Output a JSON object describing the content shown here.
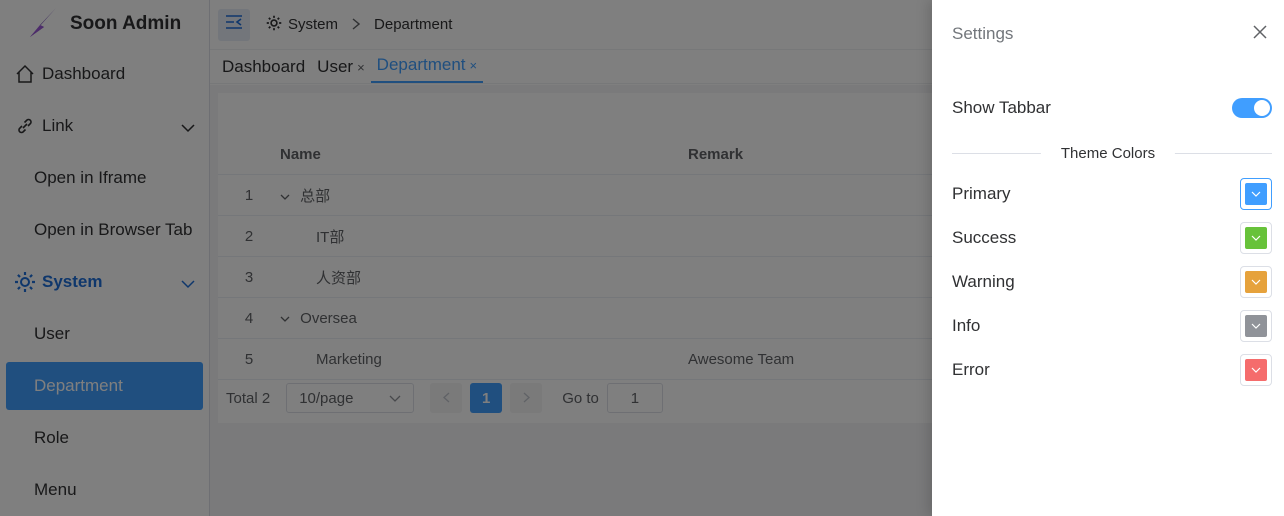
{
  "app": {
    "title": "Soon Admin"
  },
  "sidebar": {
    "items": [
      {
        "label": "Dashboard"
      },
      {
        "label": "Link"
      },
      {
        "label": "Open in Iframe"
      },
      {
        "label": "Open in Browser Tab"
      },
      {
        "label": "System"
      },
      {
        "label": "User"
      },
      {
        "label": "Department"
      },
      {
        "label": "Role"
      },
      {
        "label": "Menu"
      }
    ]
  },
  "breadcrumb": {
    "root": "System",
    "current": "Department"
  },
  "tabs": [
    {
      "label": "Dashboard"
    },
    {
      "label": "User",
      "close": "×"
    },
    {
      "label": "Department",
      "close": "×"
    }
  ],
  "table": {
    "columns": {
      "name": "Name",
      "remark": "Remark"
    },
    "rows": [
      {
        "index": "1",
        "name": "总部",
        "remark": ""
      },
      {
        "index": "2",
        "name": "IT部",
        "remark": ""
      },
      {
        "index": "3",
        "name": "人资部",
        "remark": ""
      },
      {
        "index": "4",
        "name": "Oversea",
        "remark": ""
      },
      {
        "index": "5",
        "name": "Marketing",
        "remark": "Awesome Team"
      }
    ]
  },
  "pagination": {
    "total": "Total 2",
    "page_size": "10/page",
    "current_page": "1",
    "goto_label": "Go to",
    "goto_value": "1"
  },
  "settings": {
    "title": "Settings",
    "show_tabbar_label": "Show Tabbar",
    "show_tabbar": true,
    "theme_colors_label": "Theme Colors",
    "colors": [
      {
        "label": "Primary",
        "color": "#409eff"
      },
      {
        "label": "Success",
        "color": "#67c23a"
      },
      {
        "label": "Warning",
        "color": "#e6a23c"
      },
      {
        "label": "Info",
        "color": "#909399"
      },
      {
        "label": "Error",
        "color": "#f56c6c"
      }
    ]
  }
}
